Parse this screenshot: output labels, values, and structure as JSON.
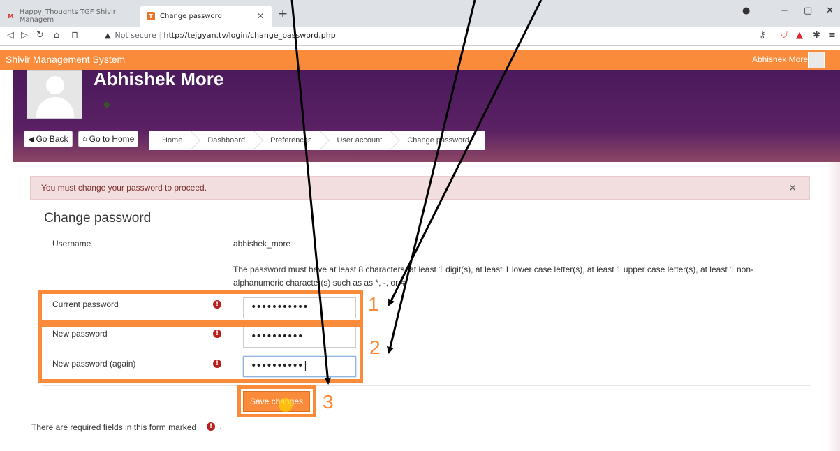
{
  "browser": {
    "tabs": [
      {
        "title": "Happy_Thoughts TGF Shivir Managem",
        "active": false
      },
      {
        "title": "Change password",
        "active": true
      }
    ],
    "url_security": "Not secure",
    "url": "http://tejgyan.tv/login/change_password.php"
  },
  "site": {
    "brand": "Shivir Management System",
    "user_name": "Abhishek More"
  },
  "profile": {
    "name": "Abhishek More"
  },
  "nav": {
    "go_back": "Go Back",
    "go_home": "Go to Home",
    "breadcrumbs": [
      "Home",
      "Dashboard",
      "Preferences",
      "User account",
      "Change password"
    ]
  },
  "alert": {
    "message": "You must change your password to proceed."
  },
  "form": {
    "title": "Change password",
    "username_label": "Username",
    "username_value": "abhishek_more",
    "rules": "The password must have at least 8 characters, at least 1 digit(s), at least 1 lower case letter(s), at least 1 upper case letter(s), at least 1 non-alphanumeric character(s) such as as *, -, or #",
    "current_label": "Current password",
    "current_value": "•••••••••••",
    "new_label": "New password",
    "new_value": "••••••••••",
    "again_label": "New password (again)",
    "again_value": "••••••••••|",
    "save_label": "Save changes",
    "required_note": "There are required fields in this form marked",
    "required_tail": "."
  },
  "annotations": {
    "n1": "1",
    "n2": "2",
    "n3": "3"
  },
  "colors": {
    "accent_orange": "#f98b3a",
    "hero_purple": "#4b1a5c",
    "required_red": "#b9201d",
    "alert_bg": "#f3dedf"
  },
  "icons": {
    "gmail": "gmail-icon",
    "site_favicon": "site-favicon-icon",
    "required": "exclamation-circle-icon",
    "back": "arrow-left-circle-icon",
    "home": "home-icon"
  }
}
